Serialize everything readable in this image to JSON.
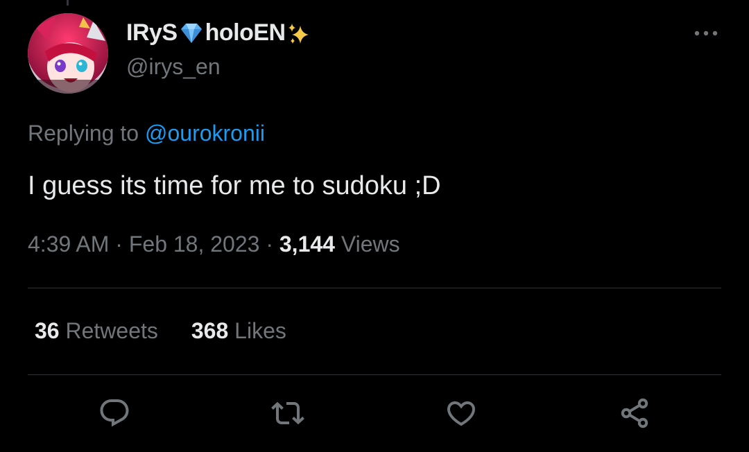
{
  "author": {
    "display_name_part1": "IRyS",
    "display_name_part2": "holoEN",
    "name_emoji_1": "gem-icon",
    "name_emoji_2": "sparkles-icon",
    "handle": "@irys_en"
  },
  "reply": {
    "prefix": "Replying to ",
    "mention": "@ourokronii"
  },
  "tweet": {
    "text": "I guess its time for me to sudoku ;D"
  },
  "meta": {
    "time": "4:39 AM",
    "separator": " · ",
    "date": "Feb 18, 2023",
    "views_count": "3,144",
    "views_label": " Views"
  },
  "stats": {
    "retweets_count": "36",
    "retweets_label": " Retweets",
    "likes_count": "368",
    "likes_label": " Likes"
  },
  "actions": [
    "reply-icon",
    "retweet-icon",
    "like-icon",
    "share-icon",
    "more-options-icon"
  ],
  "colors": {
    "background": "#000000",
    "text_primary": "#e7e9ea",
    "text_secondary": "#71767b",
    "link": "#1d9bf0",
    "divider": "#2f3336"
  }
}
